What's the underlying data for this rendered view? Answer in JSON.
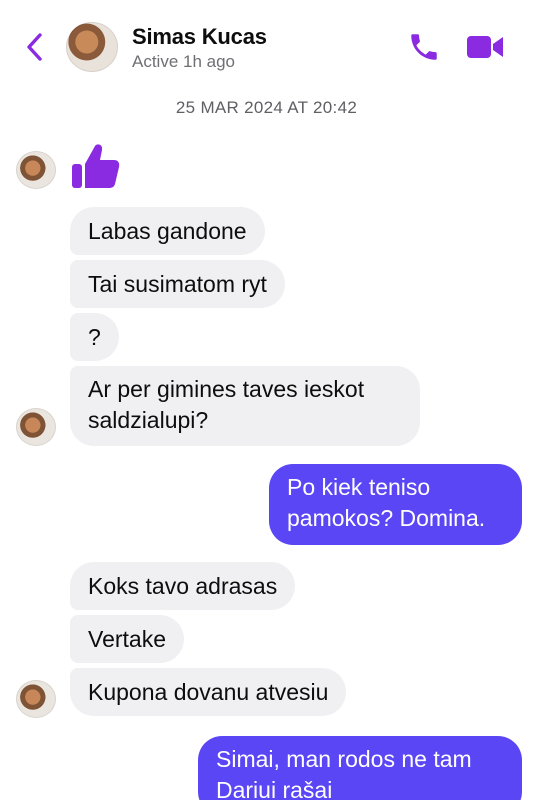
{
  "header": {
    "contact_name": "Simas Kucas",
    "status": "Active 1h ago",
    "back_icon": "chevron-left-icon",
    "call_icon": "phone-icon",
    "video_icon": "video-camera-icon",
    "accent_color": "#8a2be2"
  },
  "thread": {
    "timestamp": "25 MAR 2024 AT 20:42",
    "reaction_icon": "thumbs-up-icon",
    "incoming_bubble_color": "#f0f0f2",
    "outgoing_bubble_color": "#5b46f5",
    "messages": [
      {
        "text": "Labas gandone"
      },
      {
        "text": "Tai susimatom ryt"
      },
      {
        "text": "?"
      },
      {
        "line1": "Ar per gimines taves ieskot",
        "line2": "saldzialupi?"
      },
      {
        "line1": "Po kiek teniso",
        "line2": "pamokos? Domina."
      },
      {
        "text": "Koks tavo adrasas"
      },
      {
        "text": "Vertake"
      },
      {
        "text": "Kupona dovanu atvesiu"
      },
      {
        "line1": "Simai, man rodos ne tam",
        "line2": "Dariui rašai"
      }
    ]
  }
}
